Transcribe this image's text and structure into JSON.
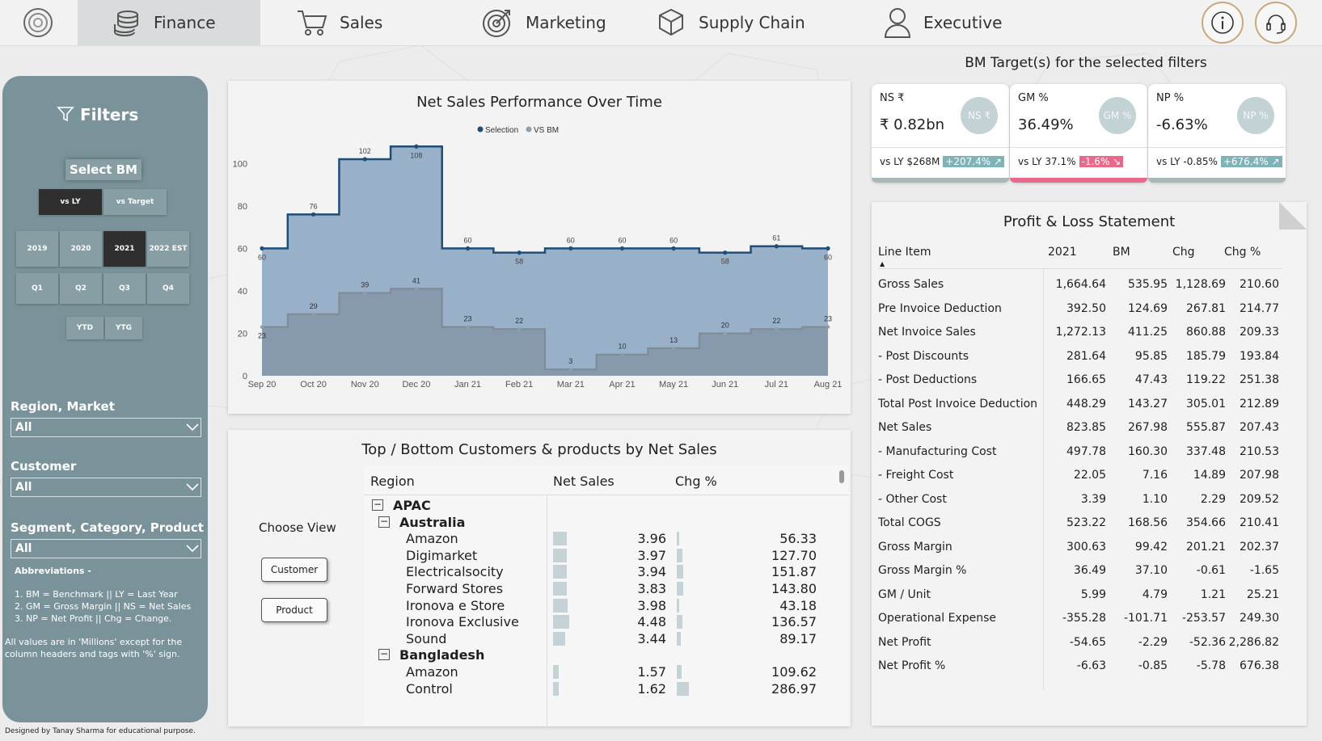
{
  "nav": {
    "tabs": [
      {
        "label": "Finance",
        "icon": "coins-icon"
      },
      {
        "label": "Sales",
        "icon": "cart-icon"
      },
      {
        "label": "Marketing",
        "icon": "target-icon"
      },
      {
        "label": "Supply Chain",
        "icon": "box-icon"
      },
      {
        "label": "Executive",
        "icon": "user-icon"
      }
    ],
    "active_tab": "Finance"
  },
  "sidebar": {
    "title": "Filters",
    "select_bm": "Select BM",
    "bm_options": [
      "vs LY",
      "vs Target"
    ],
    "bm_selected": "vs LY",
    "years": [
      "2019",
      "2020",
      "2021",
      "2022 EST"
    ],
    "year_selected": "2021",
    "quarters": [
      "Q1",
      "Q2",
      "Q3",
      "Q4"
    ],
    "periods": [
      "YTD",
      "YTG"
    ],
    "region_label": "Region, Market",
    "region_value": "All",
    "customer_label": "Customer",
    "customer_value": "All",
    "segment_label": "Segment, Category, Product",
    "segment_value": "All",
    "abbr_title": "Abbreviations -",
    "abbr_lines": [
      "1. BM = Benchmark || LY = Last Year",
      "2. GM = Gross Margin || NS = Net Sales",
      "3. NP = Net Profit || Chg = Change."
    ],
    "note_line1": "All values are in 'Millions' except for the",
    "note_line2": "column headers and tags with '%' sign."
  },
  "footer_credit": "Designed by Tanay Sharma for educational purpose.",
  "bm_targets": {
    "title": "BM Target(s) for the selected filters",
    "cards": [
      {
        "label": "NS ₹",
        "value": "₹ 0.82bn",
        "circle": "NS ₹",
        "vs_text": "vs LY $268M",
        "tag": "+207.4% ↗",
        "tag_color": "#7fb3b8",
        "bar_color": "#aab7ba"
      },
      {
        "label": "GM %",
        "value": "36.49%",
        "circle": "GM %",
        "vs_text": "vs LY 37.1%",
        "tag": "-1.6% ↘",
        "tag_color": "#e8698a",
        "bar_color": "#e8698a"
      },
      {
        "label": "NP %",
        "value": "-6.63%",
        "circle": "NP %",
        "vs_text": "vs LY -0.85%",
        "tag": "+676.4% ↗",
        "tag_color": "#7fb3b8",
        "bar_color": "#aab7ba"
      }
    ]
  },
  "pl": {
    "title": "Profit & Loss Statement",
    "headers": [
      "Line Item",
      "2021",
      "BM",
      "Chg",
      "Chg %"
    ],
    "rows": [
      [
        "Gross Sales",
        "1,664.64",
        "535.95",
        "1,128.69",
        "210.60"
      ],
      [
        "Pre Invoice Deduction",
        "392.50",
        "124.69",
        "267.81",
        "214.77"
      ],
      [
        "Net Invoice Sales",
        "1,272.13",
        "411.25",
        "860.88",
        "209.33"
      ],
      [
        "- Post Discounts",
        "281.64",
        "95.85",
        "185.79",
        "193.84"
      ],
      [
        "- Post Deductions",
        "166.65",
        "47.43",
        "119.22",
        "251.38"
      ],
      [
        "Total Post Invoice Deduction",
        "448.29",
        "143.27",
        "305.01",
        "212.89"
      ],
      [
        "Net Sales",
        "823.85",
        "267.98",
        "555.87",
        "207.43"
      ],
      [
        "- Manufacturing Cost",
        "497.78",
        "160.30",
        "337.48",
        "210.53"
      ],
      [
        "- Freight Cost",
        "22.05",
        "7.16",
        "14.89",
        "207.98"
      ],
      [
        "- Other Cost",
        "3.39",
        "1.10",
        "2.29",
        "209.52"
      ],
      [
        "Total COGS",
        "523.22",
        "168.56",
        "354.66",
        "210.41"
      ],
      [
        "Gross Margin",
        "300.63",
        "99.42",
        "201.21",
        "202.37"
      ],
      [
        "Gross Margin %",
        "36.49",
        "37.10",
        "-0.61",
        "-1.65"
      ],
      [
        "GM / Unit",
        "5.99",
        "4.79",
        "1.21",
        "25.21"
      ],
      [
        "Operational Expense",
        "-355.28",
        "-101.71",
        "-253.57",
        "249.30"
      ],
      [
        "Net Profit",
        "-54.65",
        "-2.29",
        "-52.36",
        "2,286.82"
      ],
      [
        "Net Profit %",
        "-6.63",
        "-0.85",
        "-5.78",
        "676.38"
      ]
    ]
  },
  "chart_data": {
    "type": "area",
    "title": "Net Sales Performance Over Time",
    "x": [
      "Sep 20",
      "Oct 20",
      "Nov 20",
      "Dec 20",
      "Jan 21",
      "Feb 21",
      "Mar 21",
      "Apr 21",
      "May 21",
      "Jun 21",
      "Jul 21",
      "Aug 21"
    ],
    "series": [
      {
        "name": "Selection",
        "values": [
          60,
          76,
          102,
          108,
          60,
          58,
          60,
          60,
          60,
          58,
          61,
          60
        ],
        "color": "#1f4e79"
      },
      {
        "name": "VS BM",
        "values": [
          23,
          29,
          39,
          41,
          23,
          22,
          3,
          10,
          13,
          20,
          22,
          23
        ],
        "color": "#7d8b95"
      }
    ],
    "yticks": [
      0,
      20,
      40,
      60,
      80,
      100
    ],
    "ylim": [
      0,
      110
    ],
    "legend": "top-center",
    "step": true
  },
  "customers": {
    "title": "Top / Bottom Customers & products by Net Sales",
    "choose_view": "Choose View",
    "buttons": [
      "Customer",
      "Product"
    ],
    "headers": [
      "Region",
      "Net Sales",
      "Chg %"
    ],
    "rows": [
      {
        "level": 0,
        "name": "APAC",
        "ns": "",
        "chg": "",
        "expand": true
      },
      {
        "level": 1,
        "name": "Australia",
        "ns": "",
        "chg": "",
        "expand": true
      },
      {
        "level": 2,
        "name": "Amazon",
        "ns": "3.96",
        "chg": "56.33",
        "nsv": 3.96,
        "chgv": 56.33
      },
      {
        "level": 2,
        "name": "Digimarket",
        "ns": "3.97",
        "chg": "127.70",
        "nsv": 3.97,
        "chgv": 127.7
      },
      {
        "level": 2,
        "name": "Electricalsocity",
        "ns": "3.94",
        "chg": "151.87",
        "nsv": 3.94,
        "chgv": 151.87
      },
      {
        "level": 2,
        "name": "Forward Stores",
        "ns": "3.83",
        "chg": "143.80",
        "nsv": 3.83,
        "chgv": 143.8
      },
      {
        "level": 2,
        "name": "Ironova e Store",
        "ns": "3.98",
        "chg": "43.18",
        "nsv": 3.98,
        "chgv": 43.18
      },
      {
        "level": 2,
        "name": "Ironova Exclusive",
        "ns": "4.48",
        "chg": "136.57",
        "nsv": 4.48,
        "chgv": 136.57
      },
      {
        "level": 2,
        "name": "Sound",
        "ns": "3.44",
        "chg": "89.17",
        "nsv": 3.44,
        "chgv": 89.17
      },
      {
        "level": 1,
        "name": "Bangladesh",
        "ns": "",
        "chg": "",
        "expand": true
      },
      {
        "level": 2,
        "name": "Amazon",
        "ns": "1.57",
        "chg": "109.62",
        "nsv": 1.57,
        "chgv": 109.62
      },
      {
        "level": 2,
        "name": "Control",
        "ns": "1.62",
        "chg": "286.97",
        "nsv": 1.62,
        "chgv": 286.97
      }
    ]
  }
}
